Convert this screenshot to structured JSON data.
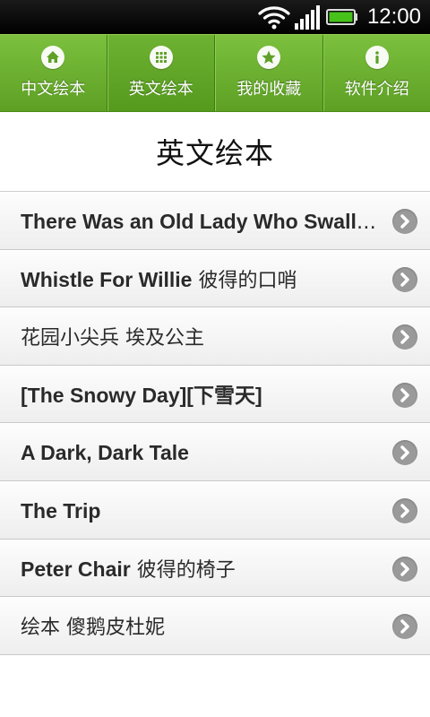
{
  "status": {
    "time": "12:00"
  },
  "tabs": [
    {
      "label": "中文绘本",
      "icon": "home-icon"
    },
    {
      "label": "英文绘本",
      "icon": "grid-icon"
    },
    {
      "label": "我的收藏",
      "icon": "star-icon"
    },
    {
      "label": "软件介绍",
      "icon": "info-icon"
    }
  ],
  "page": {
    "title": "英文绘本"
  },
  "items": [
    {
      "en": "There Was an Old Lady Who Swallo...",
      "cn": ""
    },
    {
      "en": "Whistle For Willie",
      "cn": "彼得的口哨"
    },
    {
      "en": "",
      "cn": "花园小尖兵 埃及公主"
    },
    {
      "en": "[The Snowy Day][下雪天]",
      "cn": ""
    },
    {
      "en": "A Dark, Dark Tale",
      "cn": ""
    },
    {
      "en": "The Trip",
      "cn": ""
    },
    {
      "en": "Peter Chair",
      "cn": "彼得的椅子"
    },
    {
      "en": "",
      "cn": "绘本 傻鹅皮杜妮"
    }
  ],
  "colors": {
    "tab_green": "#6ab02f",
    "chevron_gray": "#9a9a9a"
  }
}
